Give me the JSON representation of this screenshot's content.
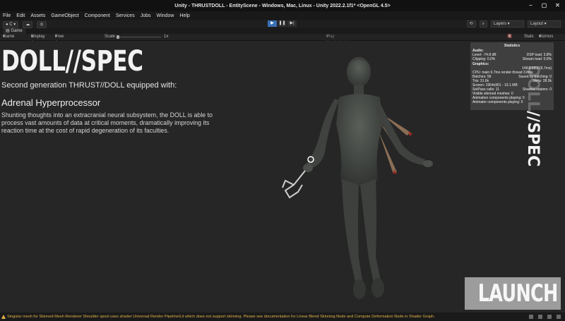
{
  "window": {
    "title": "Unity - THRUSTDOLL - EntityScene - Windows, Mac, Linux - Unity 2022.2.1f1* <OpenGL 4.5>"
  },
  "menu": [
    "File",
    "Edit",
    "Assets",
    "GameObject",
    "Component",
    "Services",
    "Jobs",
    "Window",
    "Help"
  ],
  "toolbar": {
    "account_label": "C",
    "layers_label": "Layers",
    "layout_label": "Layout"
  },
  "tab": {
    "label": "Game"
  },
  "gamebar": {
    "mode": "Game",
    "display": "Display 1",
    "aspect": "Free Aspect",
    "scale_label": "Scale",
    "scale_value": "1x",
    "play_mode": "Play Maximized",
    "stats": "Stats",
    "gizmos": "Gizmos"
  },
  "content": {
    "title": "DOLL//SPEC",
    "subtitle": "Second generation THRUST//DOLL equipped with:",
    "heading": "Adrenal Hyperprocessor",
    "description": "Shunting thoughts into an extracranial neural subsystem, the DOLL is able to process vast amounts of data at critical moments, dramatically improving its reaction time at the cost of rapid degeneration of its faculties.",
    "vertical_title": "DOLL//SPEC",
    "launch_label": "LAUNCH"
  },
  "stats": {
    "title": "Statistics",
    "audio_label": "Audio:",
    "level": "Level: -74.8 dB",
    "dsp": "DSP load: 3.8%",
    "clipping": "Clipping: 0.0%",
    "stream": "Stream load: 0.0%",
    "graphics_label": "Graphics:",
    "fps": "148.9 FPS (6.7ms)",
    "cpu": "CPU: main 6.7ms  render thread 3.8ms",
    "batches": "Batches: 58",
    "saved": "Saved by batching: 0",
    "tris": "Tris: 31.6k",
    "verts": "Verts: 28.0k",
    "screen": "Screen: 1954x901 - 19.1 MB",
    "setpass": "SetPass calls: 11",
    "shadow": "Shadow casters: 0",
    "skinned": "Visible skinned meshes: 0",
    "anim1": "Animation components playing: 0",
    "anim2": "Animator components playing: 0"
  },
  "status": {
    "message": "Singular mesh for Skinned Mesh Renderer Shoulder spool uses shader Universal Render Pipeline/Lit which does not support skinning. Please see documentation for Linear Blend Skinning Node and Compute Deformation Node in Shader Graph."
  },
  "colors": {
    "background": "#262626",
    "accent": "#3a6fb3",
    "warning": "#e0b14a",
    "launch_bg": "#9c9c9c"
  }
}
